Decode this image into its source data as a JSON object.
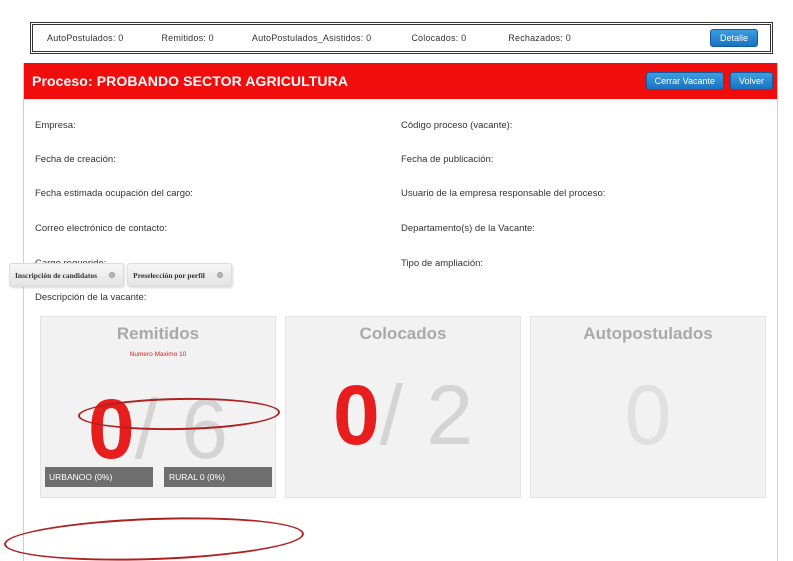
{
  "summary": {
    "stats": [
      "AutoPostulados: 0",
      "Remitidos: 0",
      "AutoPostulados_Asistidos: 0",
      "Colocados: 0",
      "Rechazados: 0"
    ],
    "detail_label": "Detalle"
  },
  "process": {
    "title": "Proceso: PROBANDO SECTOR AGRICULTURA",
    "close_label": "Cerrar Vacante",
    "back_label": "Volver",
    "colors": {
      "header": "#f20d0d",
      "button": "#1a72c0"
    }
  },
  "fields": {
    "empresa": "Empresa:",
    "codigo": "Código proceso (vacante):",
    "fecha_creacion": "Fecha de creación:",
    "fecha_publicacion": "Fecha de publicación:",
    "fecha_estimada": "Fecha estimada ocupación del cargo:",
    "usuario": "Usuario de la empresa responsable del proceso:",
    "correo": "Correo electrónico de contacto:",
    "departamento": "Departamento(s) de la Vacante:",
    "cargo": "Cargo requerido:",
    "tipo_ampliacion": "Tipo de ampliación:",
    "descripcion": "Descripción de la vacante:"
  },
  "steps": [
    "Inscripción de candidatos",
    "Preselección por perfil"
  ],
  "cards": {
    "remitidos": {
      "title": "Remitidos",
      "note": "Numero Maximo 10",
      "value": "0",
      "total": "6",
      "urbano": "URBANOO (0%)",
      "rural": "RURAL 0 (0%)"
    },
    "colocados": {
      "title": "Colocados",
      "value": "0",
      "total": "2"
    },
    "autopostulados": {
      "title": "Autopostulados",
      "value": "0"
    }
  }
}
